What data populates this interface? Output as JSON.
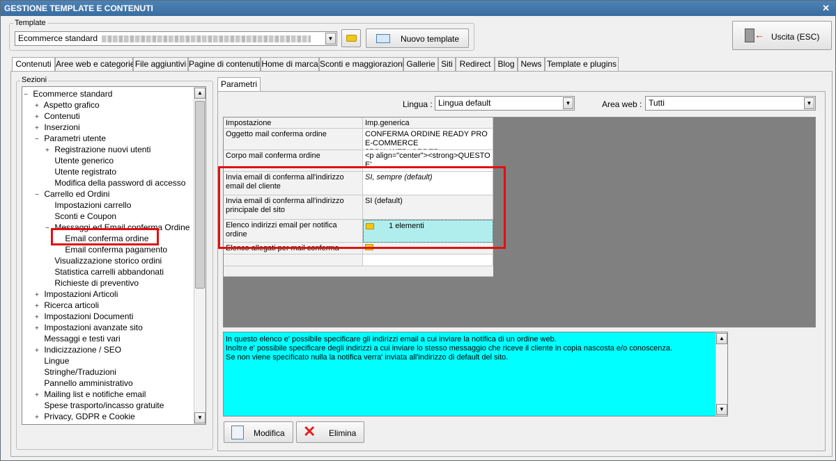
{
  "window": {
    "title": "GESTIONE TEMPLATE E CONTENUTI",
    "close": "✕"
  },
  "template": {
    "group_label": "Template",
    "selected": "Ecommerce standard",
    "new_button": "Nuovo template"
  },
  "exit_button": "Uscita (ESC)",
  "tabs": [
    "Contenuti",
    "Aree web e categorie",
    "File aggiuntivi",
    "Pagine di contenuti",
    "Home di marca",
    "Sconti e maggiorazioni",
    "Gallerie",
    "Siti",
    "Redirect",
    "Blog",
    "News",
    "Template e plugins"
  ],
  "sections_label": "Sezioni",
  "tree": [
    {
      "label": "Ecommerce standard",
      "exp": "−"
    },
    {
      "label": "Aspetto grafico",
      "exp": "+"
    },
    {
      "label": "Contenuti",
      "exp": "+"
    },
    {
      "label": "Inserzioni",
      "exp": "+"
    },
    {
      "label": "Parametri utente",
      "exp": "−"
    },
    {
      "label": "Registrazione nuovi utenti",
      "exp": "+"
    },
    {
      "label": "Utente generico",
      "exp": ""
    },
    {
      "label": "Utente registrato",
      "exp": ""
    },
    {
      "label": "Modifica della password di accesso",
      "exp": ""
    },
    {
      "label": "Carrello ed Ordini",
      "exp": "−"
    },
    {
      "label": "Impostazioni carrello",
      "exp": ""
    },
    {
      "label": "Sconti e Coupon",
      "exp": ""
    },
    {
      "label": "Messaggi ed Email conferma Ordine",
      "exp": "−"
    },
    {
      "label": "Email conferma ordine",
      "exp": ""
    },
    {
      "label": "Email conferma pagamento",
      "exp": ""
    },
    {
      "label": "Visualizzazione storico ordini",
      "exp": ""
    },
    {
      "label": "Statistica carrelli abbandonati",
      "exp": ""
    },
    {
      "label": "Richieste di preventivo",
      "exp": ""
    },
    {
      "label": "Impostazioni Articoli",
      "exp": "+"
    },
    {
      "label": "Ricerca articoli",
      "exp": "+"
    },
    {
      "label": "Impostazioni Documenti",
      "exp": "+"
    },
    {
      "label": "Impostazioni avanzate sito",
      "exp": "+"
    },
    {
      "label": "Messaggi e testi vari",
      "exp": ""
    },
    {
      "label": "Indicizzazione / SEO",
      "exp": "+"
    },
    {
      "label": "Lingue",
      "exp": ""
    },
    {
      "label": "Stringhe/Traduzioni",
      "exp": ""
    },
    {
      "label": "Pannello amministrativo",
      "exp": ""
    },
    {
      "label": "Mailing list e notifiche email",
      "exp": "+"
    },
    {
      "label": "Spese trasporto/incasso gratuite",
      "exp": ""
    },
    {
      "label": "Privacy, GDPR e Cookie",
      "exp": "+"
    }
  ],
  "params_tab": "Parametri",
  "lingua": {
    "label": "Lingua :",
    "value": "Lingua default"
  },
  "area_web": {
    "label": "Area web :",
    "value": "Tutti"
  },
  "grid": {
    "headers": [
      "Impostazione",
      "Imp.generica"
    ],
    "rows": [
      {
        "name": "Oggetto mail conferma ordine",
        "value": "CONFERMA ORDINE READY PRO E-COMMERCE $RDY_WEB_ORDER..."
      },
      {
        "name": "Corpo mail conferma ordine",
        "value": "<p align=\"center\"><strong>QUESTO E'"
      },
      {
        "name": "Invia email di conferma all'indirizzo email del cliente",
        "value": "SI, sempre (default)"
      },
      {
        "name": "Invia email di conferma all'indirizzo principale del sito",
        "value": "SI (default)"
      },
      {
        "name": "Elenco indirizzi email per notifica ordine",
        "value": "1 elementi"
      },
      {
        "name": "Elenco allegati per mail conferma ordine",
        "value": ""
      },
      {
        "name": "",
        "value": ""
      }
    ]
  },
  "description": [
    "In questo elenco e' possibile specificare gli indirizzi email a cui inviare la notifica di un ordine web.",
    "Inoltre e' possibile specificare degli indirizzi a cui inviare lo stesso messaggio che riceve il cliente in copia nascosta e/o conoscenza.",
    "Se non viene specificato nulla la notifica verra' inviata all'indirizzo di default del sito."
  ],
  "buttons": {
    "edit": "Modifica",
    "delete": "Elimina"
  },
  "colors": {
    "titlebar": "#3a6d9f",
    "highlight": "#e01010",
    "description_bg": "#00ffff",
    "selected_cell": "#b0eeee"
  }
}
